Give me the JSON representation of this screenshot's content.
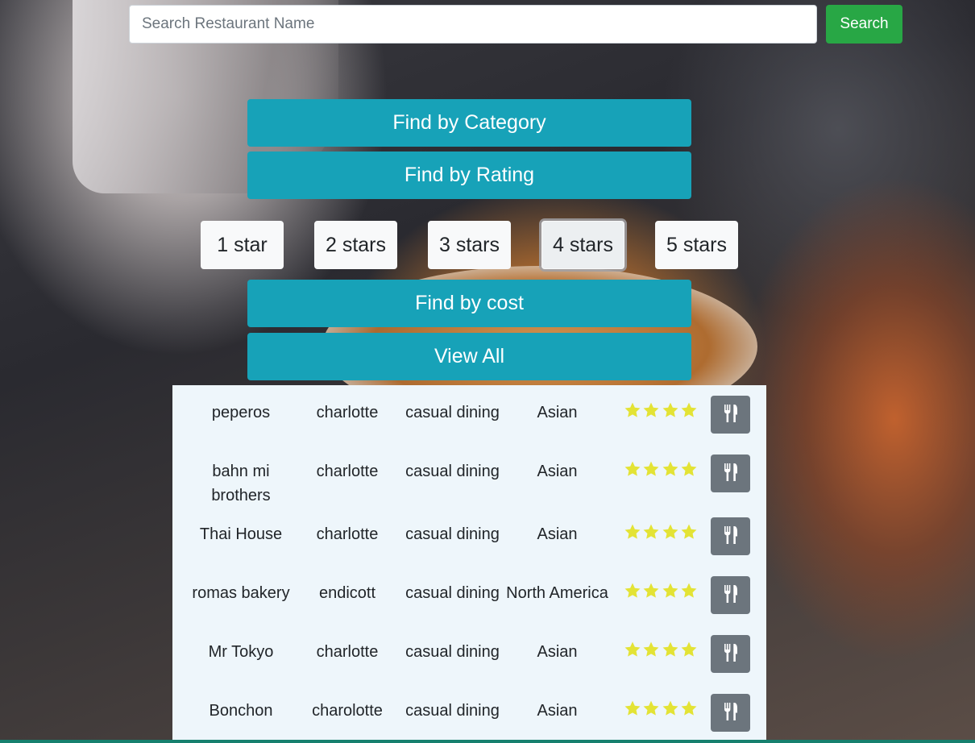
{
  "search": {
    "placeholder": "Search Restaurant Name",
    "button_label": "Search"
  },
  "filters": {
    "category_label": "Find by Category",
    "rating_label": "Find by Rating",
    "cost_label": "Find by cost",
    "view_all_label": "View All",
    "rating_options": [
      {
        "label": "1 star",
        "active": false
      },
      {
        "label": "2 stars",
        "active": false
      },
      {
        "label": "3 stars",
        "active": false
      },
      {
        "label": "4 stars",
        "active": true
      },
      {
        "label": "5 stars",
        "active": false
      }
    ]
  },
  "results": [
    {
      "name": "peperos",
      "city": "charlotte",
      "type": "casual dining",
      "cuisine": "Asian",
      "rating": 4
    },
    {
      "name": "bahn mi brothers",
      "city": "charlotte",
      "type": "casual dining",
      "cuisine": "Asian",
      "rating": 4
    },
    {
      "name": "Thai House",
      "city": "charlotte",
      "type": "casual dining",
      "cuisine": "Asian",
      "rating": 4
    },
    {
      "name": "romas bakery",
      "city": "endicott",
      "type": "casual dining",
      "cuisine": "North America",
      "rating": 4
    },
    {
      "name": "Mr Tokyo",
      "city": "charlotte",
      "type": "casual dining",
      "cuisine": "Asian",
      "rating": 4
    },
    {
      "name": "Bonchon",
      "city": "charolotte",
      "type": "casual dining",
      "cuisine": "Asian",
      "rating": 4
    }
  ],
  "icons": {
    "star": "star-icon",
    "dine": "fork-knife-icon"
  },
  "colors": {
    "search_button": "#28a745",
    "filter_button": "#17a2b8",
    "star": "#e3e335",
    "dine_button": "#6c757d",
    "results_background": "#eef6fb"
  }
}
